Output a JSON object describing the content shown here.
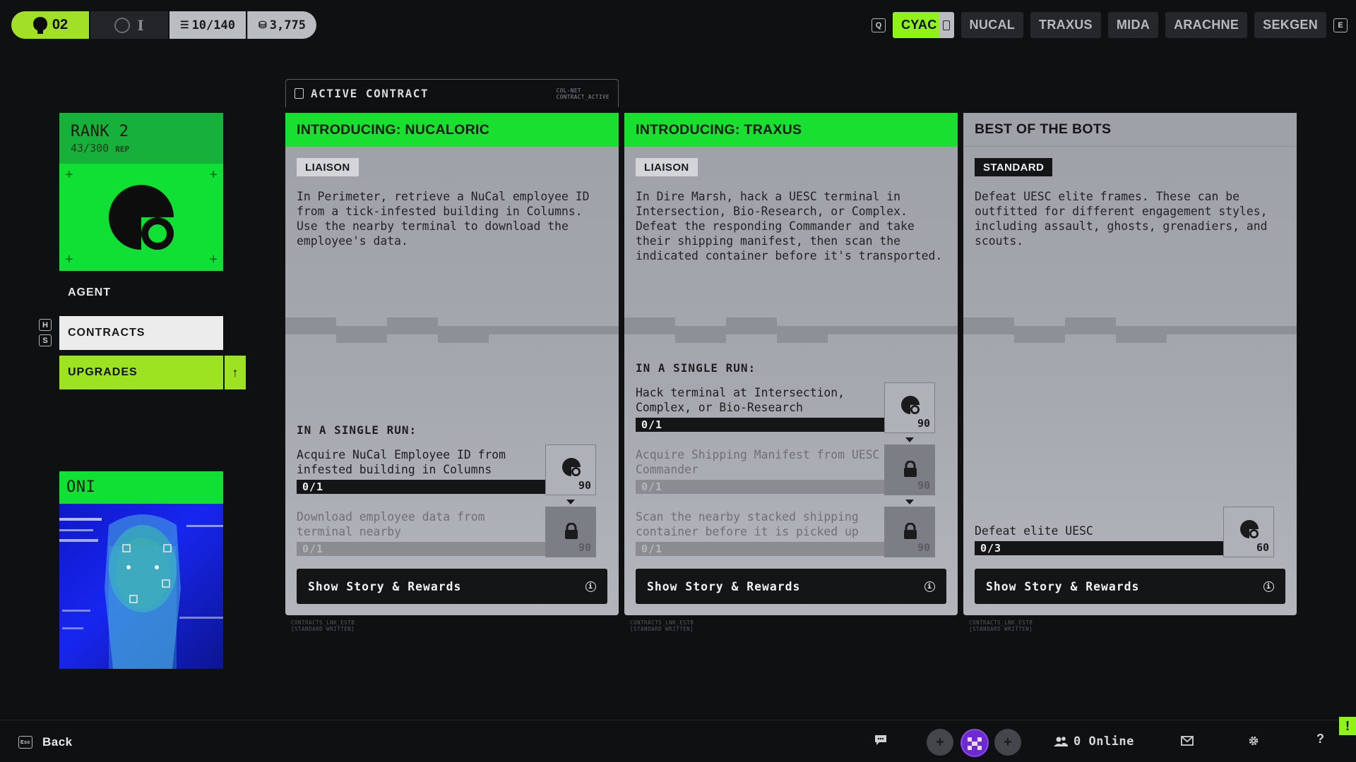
{
  "topbar": {
    "level": "02",
    "slot_label": "I",
    "inventory": "10/140",
    "currency": "3,775"
  },
  "factions": {
    "left_key": "Q",
    "right_key": "E",
    "items": [
      {
        "label": "CYAC",
        "active": true
      },
      {
        "label": "NUCAL",
        "active": false
      },
      {
        "label": "TRAXUS",
        "active": false
      },
      {
        "label": "MIDA",
        "active": false
      },
      {
        "label": "ARACHNE",
        "active": false
      },
      {
        "label": "SEKGEN",
        "active": false
      }
    ]
  },
  "rank": {
    "title": "RANK 2",
    "rep": "43/300",
    "rep_unit": "REP"
  },
  "nav": {
    "agent": "AGENT",
    "contracts": "CONTRACTS",
    "upgrades": "UPGRADES",
    "key_h": "H",
    "key_s": "S"
  },
  "agent_card": {
    "name": "ONI"
  },
  "active_tab": {
    "label": "ACTIVE CONTRACT",
    "meta_1": "COL-NET",
    "meta_2": "CONTRACT_ACTIVE"
  },
  "cards": [
    {
      "title": "INTRODUCING: NUCALORIC",
      "badge": "LIAISON",
      "description": "In Perimeter, retrieve a NuCal employee ID from a tick-infested building in Columns. Use the nearby terminal to download the employee's data.",
      "section_label": "IN A SINGLE RUN:",
      "objectives": [
        {
          "text": "Acquire NuCal Employee ID from infested building in Columns",
          "progress": "0/1",
          "reward": "90",
          "locked": false
        },
        {
          "text": "Download employee data from terminal nearby",
          "progress": "0/1",
          "reward": "90",
          "locked": true
        }
      ],
      "button": "Show Story & Rewards",
      "footer_1": "CONTRACTS_LNK_ESTB",
      "footer_2": "[STANDARD WRITTEN]"
    },
    {
      "title": "INTRODUCING: TRAXUS",
      "badge": "LIAISON",
      "description": "In Dire Marsh, hack a UESC terminal in Intersection, Bio-Research, or Complex. Defeat the responding Commander and take their shipping manifest, then scan the indicated container before it's transported.",
      "section_label": "IN A SINGLE RUN:",
      "objectives": [
        {
          "text": "Hack terminal at Intersection, Complex, or Bio-Research",
          "progress": "0/1",
          "reward": "90",
          "locked": false
        },
        {
          "text": "Acquire Shipping Manifest from UESC Commander",
          "progress": "0/1",
          "reward": "90",
          "locked": true
        },
        {
          "text": "Scan the nearby stacked shipping container before it is picked up",
          "progress": "0/1",
          "reward": "90",
          "locked": true
        }
      ],
      "button": "Show Story & Rewards",
      "footer_1": "CONTRACTS_LNK_ESTB",
      "footer_2": "[STANDARD WRITTEN]"
    },
    {
      "title": "BEST OF THE BOTS",
      "badge": "STANDARD",
      "description": "Defeat UESC elite frames. These can be outfitted for different engagement styles, including assault, ghosts, grenadiers, and scouts.",
      "objectives": [
        {
          "text": "Defeat elite UESC",
          "progress": "0/3",
          "reward": "60",
          "locked": false
        }
      ],
      "button": "Show Story & Rewards",
      "footer_1": "CONTRACTS_LNK_ESTB",
      "footer_2": "[STANDARD WRITTEN]"
    }
  ],
  "bottombar": {
    "back": "Back",
    "back_key": "Esc",
    "online": "0 Online",
    "help": "?",
    "alert": "!"
  },
  "colors": {
    "accent_green": "#19e030",
    "lime": "#9ee321",
    "card_grey": "#a4a7ae",
    "dark": "#141517"
  }
}
